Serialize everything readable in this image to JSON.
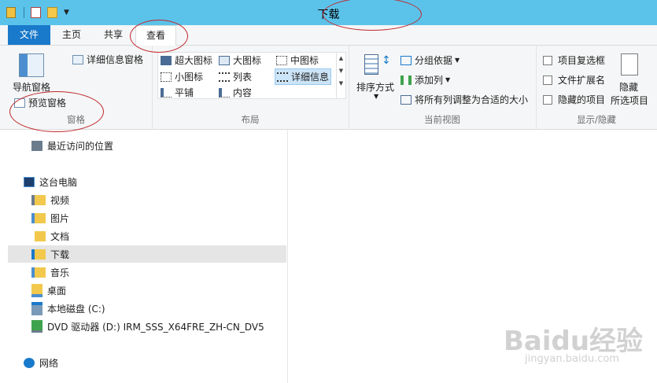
{
  "window": {
    "title": "下载"
  },
  "tabs": {
    "file": "文件",
    "home": "主页",
    "share": "共享",
    "view": "查看"
  },
  "ribbon": {
    "pane": {
      "nav_pane": "导航窗格",
      "preview_pane": "预览窗格",
      "details_pane": "详细信息窗格",
      "label": "窗格"
    },
    "layout": {
      "extra_large": "超大图标",
      "large": "大图标",
      "medium": "中图标",
      "small": "小图标",
      "list": "列表",
      "details": "详细信息",
      "tiles": "平铺",
      "content": "内容",
      "label": "布局"
    },
    "current_view": {
      "sort_by": "排序方式",
      "group_by": "分组依据",
      "add_columns": "添加列",
      "size_all_columns": "将所有列调整为合适的大小",
      "label": "当前视图"
    },
    "show_hide": {
      "item_checkboxes": "项目复选框",
      "file_extensions": "文件扩展名",
      "hidden_items": "隐藏的项目",
      "hide_selected": "隐藏",
      "hide_selected_2": "所选项目",
      "label": "显示/隐藏"
    }
  },
  "nav": {
    "recent": "最近访问的位置",
    "this_pc": "这台电脑",
    "videos": "视频",
    "pictures": "图片",
    "documents": "文档",
    "downloads": "下载",
    "music": "音乐",
    "desktop": "桌面",
    "local_disk": "本地磁盘 (C:)",
    "dvd": "DVD 驱动器 (D:) IRM_SSS_X64FRE_ZH-CN_DV5",
    "network": "网络"
  },
  "watermark": {
    "brand": "Baidu经验",
    "url": "jingyan.baidu.com"
  },
  "colors": {
    "titlebar": "#5bc3ea",
    "file_tab": "#1979ca",
    "annotation": "#c0282e",
    "selected": "#e5e5e5"
  }
}
